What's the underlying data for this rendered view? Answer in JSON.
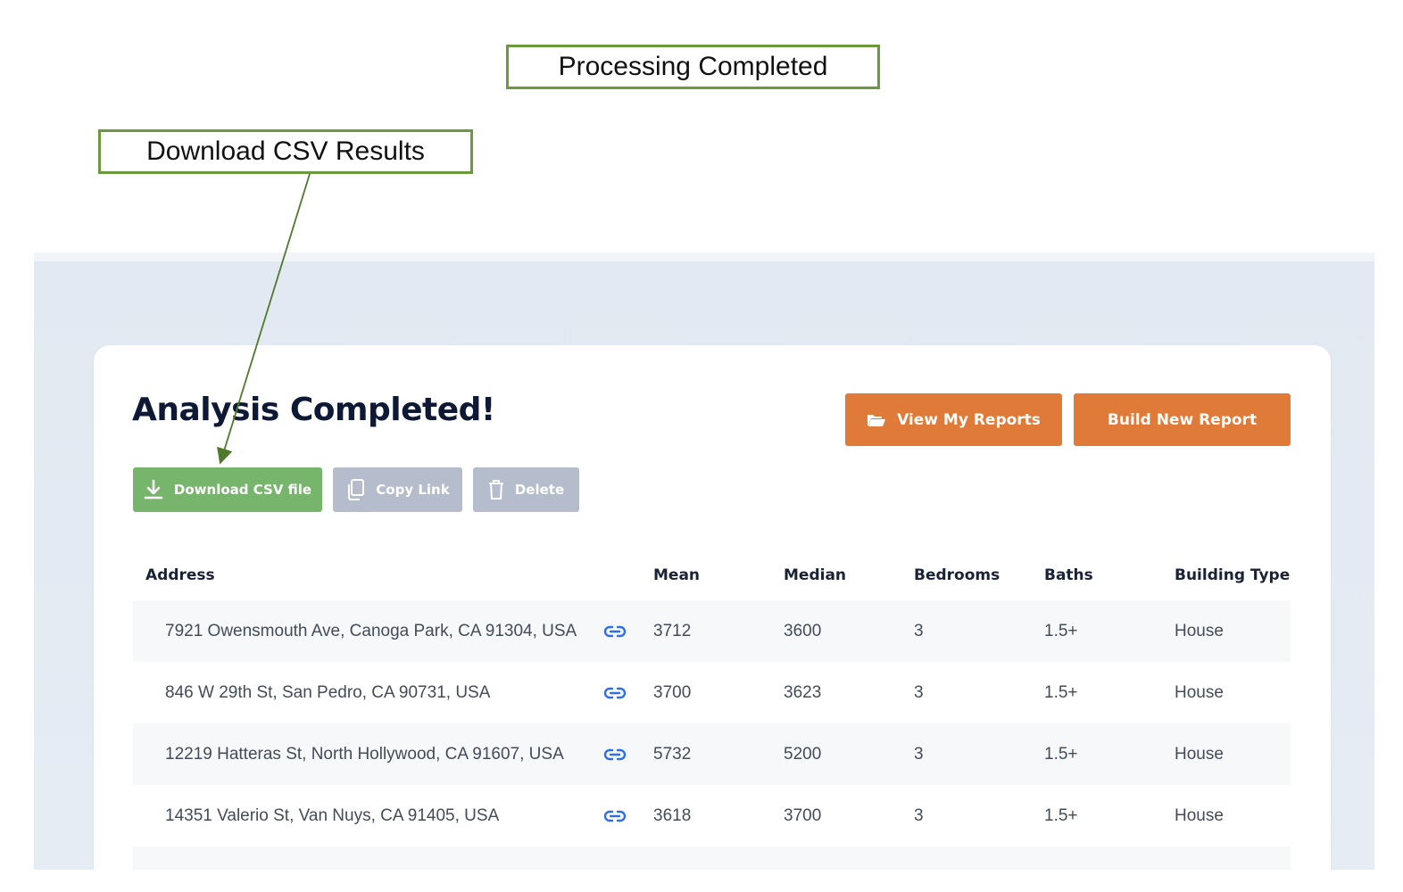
{
  "annotations": {
    "processing": "Processing Completed",
    "download": "Download CSV Results"
  },
  "page": {
    "title": "Analysis Completed!"
  },
  "actions": {
    "view_reports": "View My Reports",
    "build_report": "Build New Report",
    "download_csv": "Download CSV file",
    "copy_link": "Copy Link",
    "delete": "Delete"
  },
  "colors": {
    "accent_orange": "#e07a39",
    "download_green": "#77b46c",
    "disabled_gray": "#b5bccb",
    "link_blue": "#2f6fe8",
    "callout_border": "#6b9a3e"
  },
  "icons": {
    "view_reports": "folder-open-icon",
    "download": "download-icon",
    "copy": "copy-icon",
    "delete": "trash-icon",
    "row_link": "link-icon"
  },
  "table": {
    "headers": {
      "address": "Address",
      "mean": "Mean",
      "median": "Median",
      "bedrooms": "Bedrooms",
      "baths": "Baths",
      "building_type": "Building Type"
    },
    "rows": [
      {
        "address": "7921 Owensmouth Ave, Canoga Park, CA 91304, USA",
        "mean": "3712",
        "median": "3600",
        "bedrooms": "3",
        "baths": "1.5+",
        "building_type": "House"
      },
      {
        "address": "846 W 29th St, San Pedro, CA 90731, USA",
        "mean": "3700",
        "median": "3623",
        "bedrooms": "3",
        "baths": "1.5+",
        "building_type": "House"
      },
      {
        "address": "12219 Hatteras St, North Hollywood, CA 91607, USA",
        "mean": "5732",
        "median": "5200",
        "bedrooms": "3",
        "baths": "1.5+",
        "building_type": "House"
      },
      {
        "address": "14351 Valerio St, Van Nuys, CA 91405, USA",
        "mean": "3618",
        "median": "3700",
        "bedrooms": "3",
        "baths": "1.5+",
        "building_type": "House"
      }
    ]
  }
}
